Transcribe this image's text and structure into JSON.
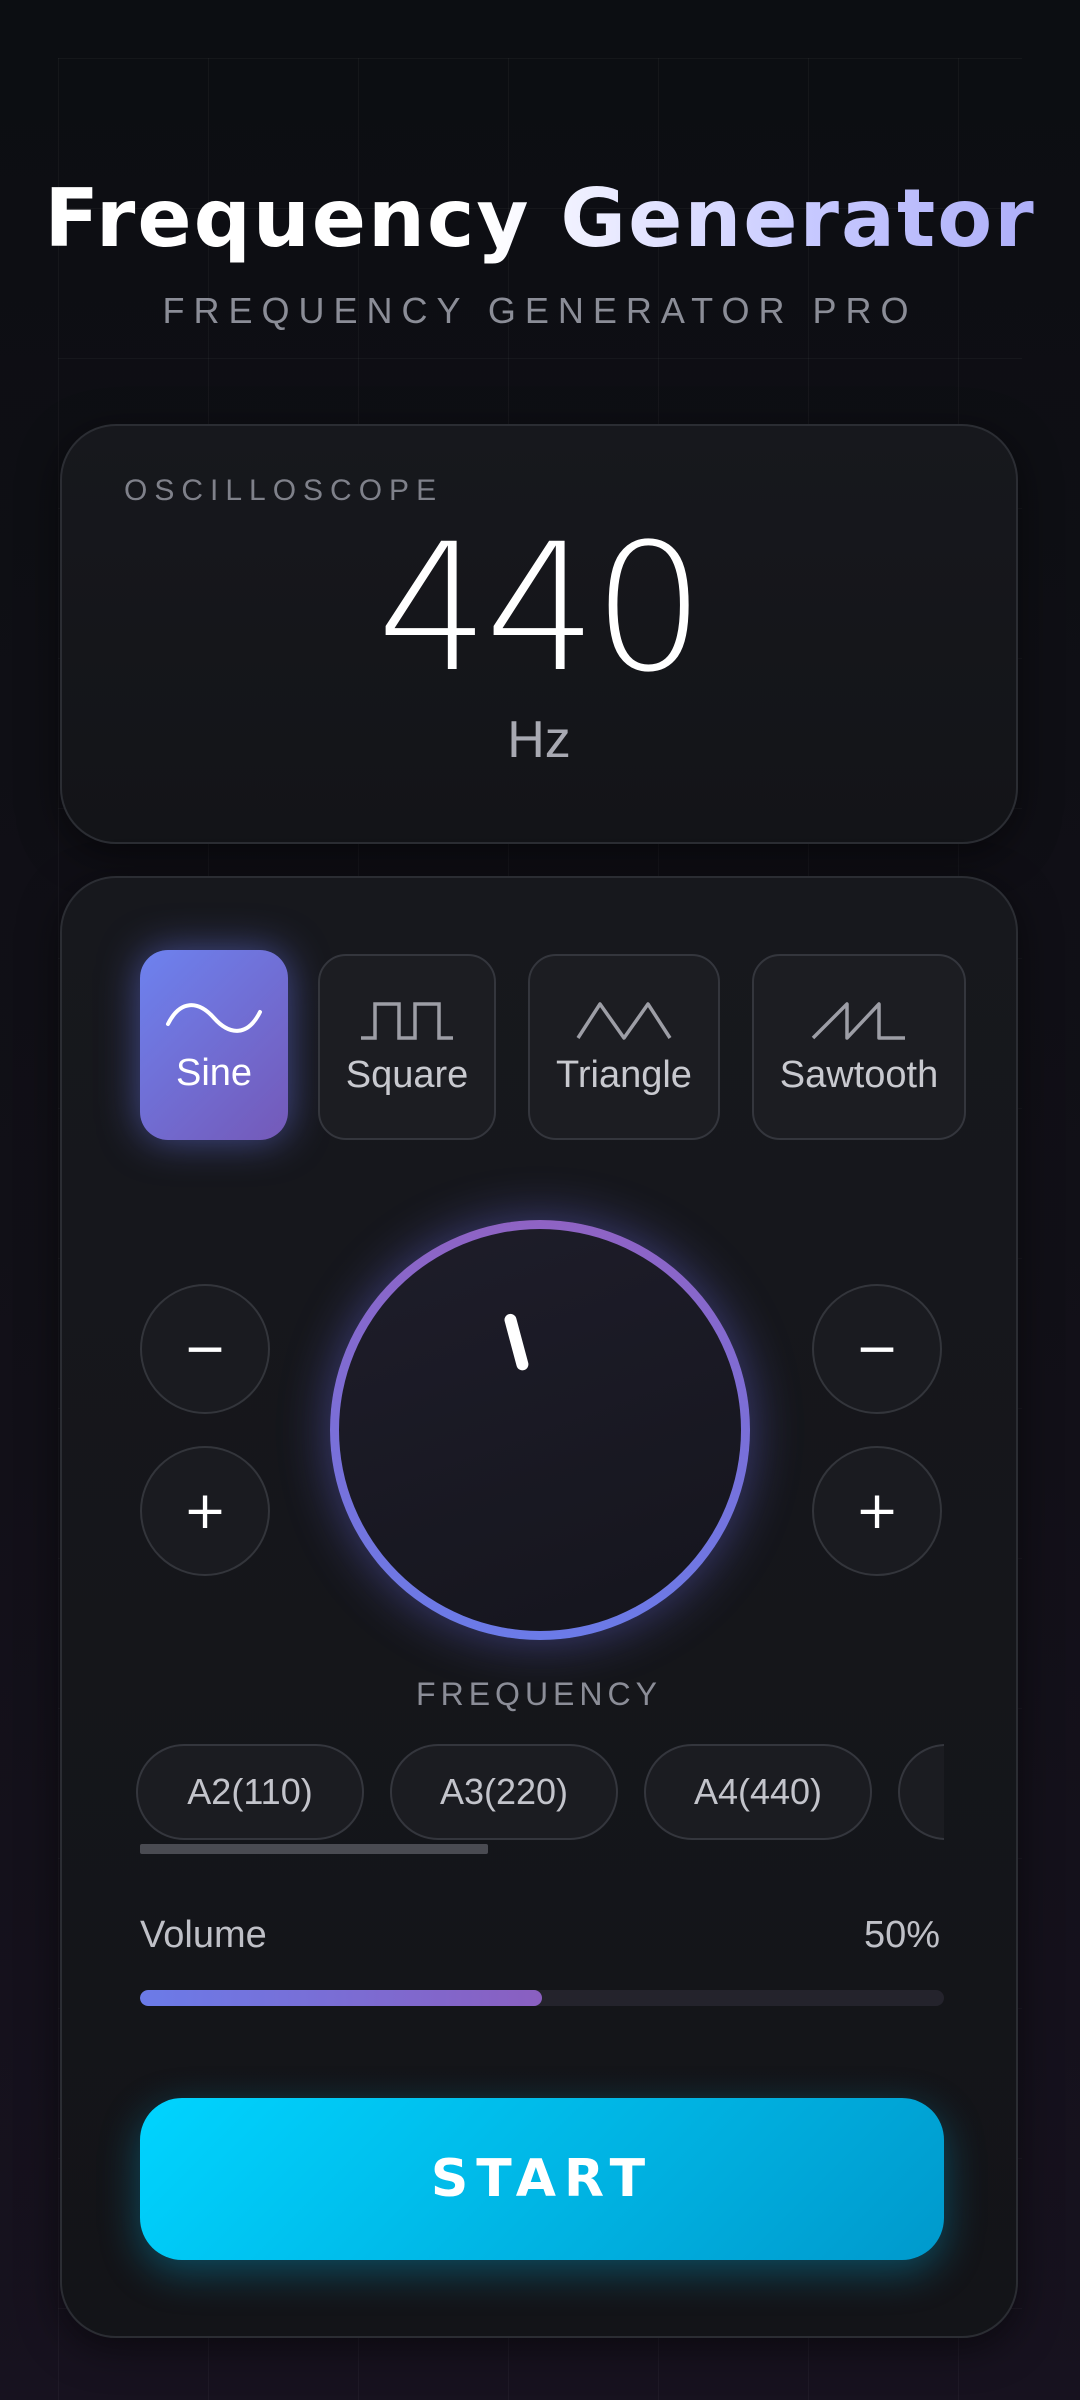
{
  "header": {
    "title": "Frequency Generator",
    "subtitle": "FREQUENCY GENERATOR PRO"
  },
  "oscilloscope": {
    "label": "OSCILLOSCOPE",
    "frequency_value": "440",
    "unit": "Hz"
  },
  "waveforms": [
    {
      "label": "Sine",
      "icon": "sine-wave-icon",
      "active": true
    },
    {
      "label": "Square",
      "icon": "square-wave-icon",
      "active": false
    },
    {
      "label": "Triangle",
      "icon": "triangle-wave-icon",
      "active": false
    },
    {
      "label": "Sawtooth",
      "icon": "sawtooth-wave-icon",
      "active": false
    }
  ],
  "steppers": {
    "left_minus": "−",
    "left_plus": "+",
    "right_minus": "−",
    "right_plus": "+"
  },
  "dial": {
    "label": "FREQUENCY"
  },
  "presets": [
    "A2(110)",
    "A3(220)",
    "A4(440)",
    ""
  ],
  "volume": {
    "label": "Volume",
    "value_text": "50%",
    "level": 0.5
  },
  "actions": {
    "start_label": "START"
  },
  "colors": {
    "accent_start": "#00d4ff",
    "accent_end": "#0099cc",
    "dial_ring": "#7a6fd8",
    "active_wave": "#6d82ef"
  }
}
